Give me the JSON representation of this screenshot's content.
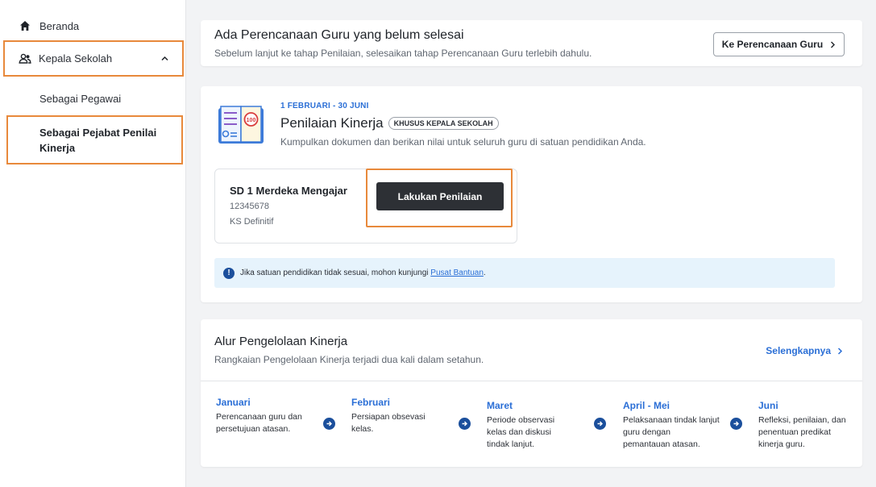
{
  "sidebar": {
    "home": "Beranda",
    "kepala": "Kepala Sekolah",
    "sub1": "Sebagai Pegawai",
    "sub2": "Sebagai Pejabat Penilai Kinerja"
  },
  "banner": {
    "title": "Ada Perencanaan Guru yang belum selesai",
    "subtitle": "Sebelum lanjut ke tahap Penilaian, selesaikan tahap Perencanaan Guru terlebih dahulu.",
    "button": "Ke Perencanaan Guru"
  },
  "penilaian": {
    "date": "1 FEBRUARI - 30 JUNI",
    "title": "Penilaian Kinerja",
    "badge": "KHUSUS KEPALA SEKOLAH",
    "subtitle": "Kumpulkan dokumen dan berikan nilai untuk seluruh guru di satuan pendidikan Anda.",
    "school_name": "SD 1 Merdeka Mengajar",
    "school_npsn": "12345678",
    "school_role": "KS Definitif",
    "button": "Lakukan Penilaian",
    "info_text": "Jika satuan pendidikan tidak sesuai, mohon kunjungi",
    "info_link": "Pusat Bantuan",
    "info_end": "."
  },
  "alur": {
    "title": "Alur Pengelolaan Kinerja",
    "subtitle": "Rangkaian Pengelolaan Kinerja terjadi dua kali dalam setahun.",
    "more": "Selengkapnya",
    "steps": [
      {
        "month": "Januari",
        "desc": "Perencanaan guru dan persetujuan atasan."
      },
      {
        "month": "Februari",
        "desc": "Persiapan obsevasi kelas."
      },
      {
        "month": "Maret",
        "desc": "Periode observasi kelas dan diskusi tindak lanjut."
      },
      {
        "month": "April - Mei",
        "desc": "Pelaksanaan tindak lanjut guru dengan pemantauan atasan."
      },
      {
        "month": "Juni",
        "desc": "Refleksi, penilaian, dan penentuan predikat kinerja guru."
      }
    ]
  },
  "colors": {
    "accent_blue": "#2b6fd6",
    "highlight_orange": "#e8893b",
    "dark_button": "#2d3035",
    "info_bg": "#e6f3fc"
  },
  "icons": {
    "home": "home-icon",
    "people": "people-icon",
    "chevron_up": "chevron-up-icon",
    "chevron_right": "chevron-right-icon",
    "info": "info-icon",
    "arrow_right": "arrow-right-circle-icon",
    "book": "book-score-icon"
  }
}
